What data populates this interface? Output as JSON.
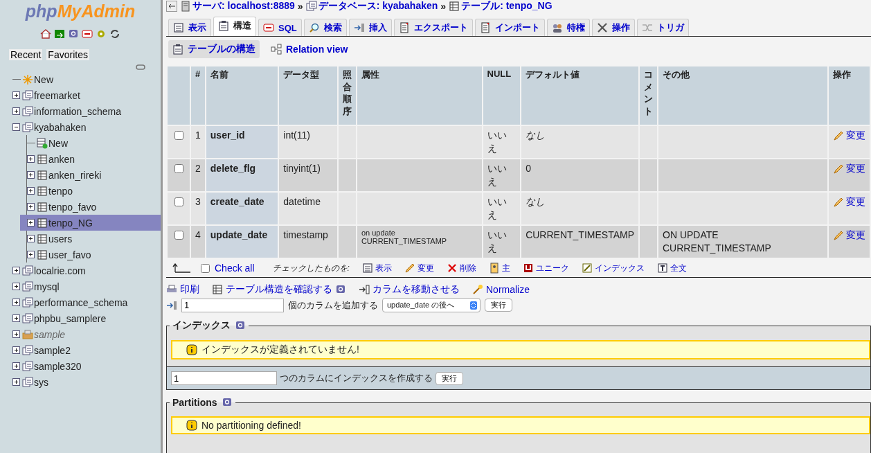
{
  "sidebar": {
    "logo": {
      "prefix": "php",
      "name": "MyAdmin"
    },
    "tabs": [
      {
        "label": "Recent"
      },
      {
        "label": "Favorites"
      }
    ],
    "tree": [
      {
        "label": "New",
        "kind": "new",
        "selected": false
      },
      {
        "label": "freemarket",
        "kind": "database",
        "expanded": false,
        "selected": false
      },
      {
        "label": "information_schema",
        "kind": "database",
        "expanded": false,
        "selected": false
      },
      {
        "label": "kyabahaken",
        "kind": "database",
        "expanded": true,
        "selected": false,
        "children": [
          {
            "label": "New",
            "kind": "new-table",
            "selected": false
          },
          {
            "label": "anken",
            "kind": "table",
            "expanded": false,
            "selected": false
          },
          {
            "label": "anken_rireki",
            "kind": "table",
            "expanded": false,
            "selected": false
          },
          {
            "label": "tenpo",
            "kind": "table",
            "expanded": false,
            "selected": false
          },
          {
            "label": "tenpo_favo",
            "kind": "table",
            "expanded": false,
            "selected": false
          },
          {
            "label": "tenpo_NG",
            "kind": "table",
            "expanded": false,
            "selected": true
          },
          {
            "label": "users",
            "kind": "table",
            "expanded": false,
            "selected": false
          },
          {
            "label": "user_favo",
            "kind": "table",
            "expanded": false,
            "selected": false
          }
        ]
      },
      {
        "label": "localrie.com",
        "kind": "database",
        "expanded": false,
        "selected": false
      },
      {
        "label": "mysql",
        "kind": "database",
        "expanded": false,
        "selected": false
      },
      {
        "label": "performance_schema",
        "kind": "database",
        "expanded": false,
        "selected": false
      },
      {
        "label": "phpbu_samplere",
        "kind": "database",
        "expanded": false,
        "selected": false
      },
      {
        "label": "sample",
        "kind": "box",
        "expanded": false,
        "selected": false
      },
      {
        "label": "sample2",
        "kind": "database",
        "expanded": false,
        "selected": false
      },
      {
        "label": "sample320",
        "kind": "database",
        "expanded": false,
        "selected": false
      },
      {
        "label": "sys",
        "kind": "database",
        "expanded": false,
        "selected": false
      }
    ]
  },
  "breadcrumb": [
    {
      "label": "サーバ: localhost:8889",
      "kind": "server"
    },
    {
      "separator_before": "»",
      "label": "データベース: kyabahaken",
      "kind": "database"
    },
    {
      "separator_before": "»",
      "label": "テーブル: tenpo_NG",
      "kind": "table"
    }
  ],
  "tabs": [
    {
      "label": "表示",
      "selected": false
    },
    {
      "label": "構造",
      "selected": true
    },
    {
      "label": "SQL",
      "selected": false
    },
    {
      "label": "検索",
      "selected": false
    },
    {
      "label": "挿入",
      "selected": false
    },
    {
      "label": "エクスポート",
      "selected": false
    },
    {
      "label": "インポート",
      "selected": false
    },
    {
      "label": "特権",
      "selected": false
    },
    {
      "label": "操作",
      "selected": false
    },
    {
      "label": "トリガ",
      "selected": false
    }
  ],
  "subtabs": [
    {
      "label": "テーブルの構造",
      "selected": true
    },
    {
      "label": "Relation view",
      "selected": false
    }
  ],
  "table": {
    "columns": [
      {
        "label": "#",
        "kind": "plain"
      },
      {
        "label": "名前",
        "kind": "plain"
      },
      {
        "label": "データ型",
        "kind": "plain"
      },
      {
        "label": "照合順序",
        "kind": "stacked"
      },
      {
        "label": "属性",
        "kind": "plain"
      },
      {
        "label": "NULL",
        "kind": "plain"
      },
      {
        "label": "デフォルト値",
        "kind": "plain"
      },
      {
        "label": "コメント",
        "kind": "stacked"
      },
      {
        "label": "その他",
        "kind": "plain"
      },
      {
        "label": "操作",
        "kind": "plain"
      }
    ],
    "rows": [
      {
        "checked": false,
        "number": "1",
        "name": "user_id",
        "type": "int(11)",
        "attributes": "",
        "null": "いいえ",
        "default": "なし",
        "default_is_none": true,
        "extra": "",
        "action": "変更"
      },
      {
        "checked": false,
        "number": "2",
        "name": "delete_flg",
        "type": "tinyint(1)",
        "attributes": "",
        "null": "いいえ",
        "default": "0",
        "default_is_none": false,
        "extra": "",
        "action": "変更"
      },
      {
        "checked": false,
        "number": "3",
        "name": "create_date",
        "type": "datetime",
        "attributes": "",
        "null": "いいえ",
        "default": "なし",
        "default_is_none": true,
        "extra": "",
        "action": "変更"
      },
      {
        "checked": false,
        "number": "4",
        "name": "update_date",
        "type": "timestamp",
        "attributes": "on update CURRENT_TIMESTAMP",
        "null": "いいえ",
        "default": "CURRENT_TIMESTAMP",
        "default_is_none": false,
        "extra": "ON UPDATE CURRENT_TIMESTAMP",
        "action": "変更"
      }
    ]
  },
  "bulk": {
    "check_all": {
      "label": "Check all",
      "checked": false
    },
    "with_selected": "チェックしたものを:",
    "actions": [
      {
        "label": "表示"
      },
      {
        "label": "変更"
      },
      {
        "label": "削除"
      },
      {
        "label": "主"
      },
      {
        "label": "ユニーク"
      },
      {
        "label": "インデックス"
      },
      {
        "label": "全文"
      }
    ]
  },
  "tools": [
    {
      "label": "印刷",
      "help": false
    },
    {
      "label": "テーブル構造を確認する",
      "help": true
    },
    {
      "label": "カラムを移動させる",
      "help": false
    },
    {
      "label": "Normalize",
      "help": false
    }
  ],
  "add_column": {
    "value": "1",
    "label": "個のカラムを追加する",
    "position": "update_date の後へ",
    "button": "実行"
  },
  "indexes": {
    "legend": "インデックス",
    "notice": "インデックスが定義されていません!",
    "value": "1",
    "label": "つのカラムにインデックスを作成する",
    "button": "実行"
  },
  "partitions": {
    "legend": "Partitions",
    "notice": "No partitioning defined!"
  }
}
